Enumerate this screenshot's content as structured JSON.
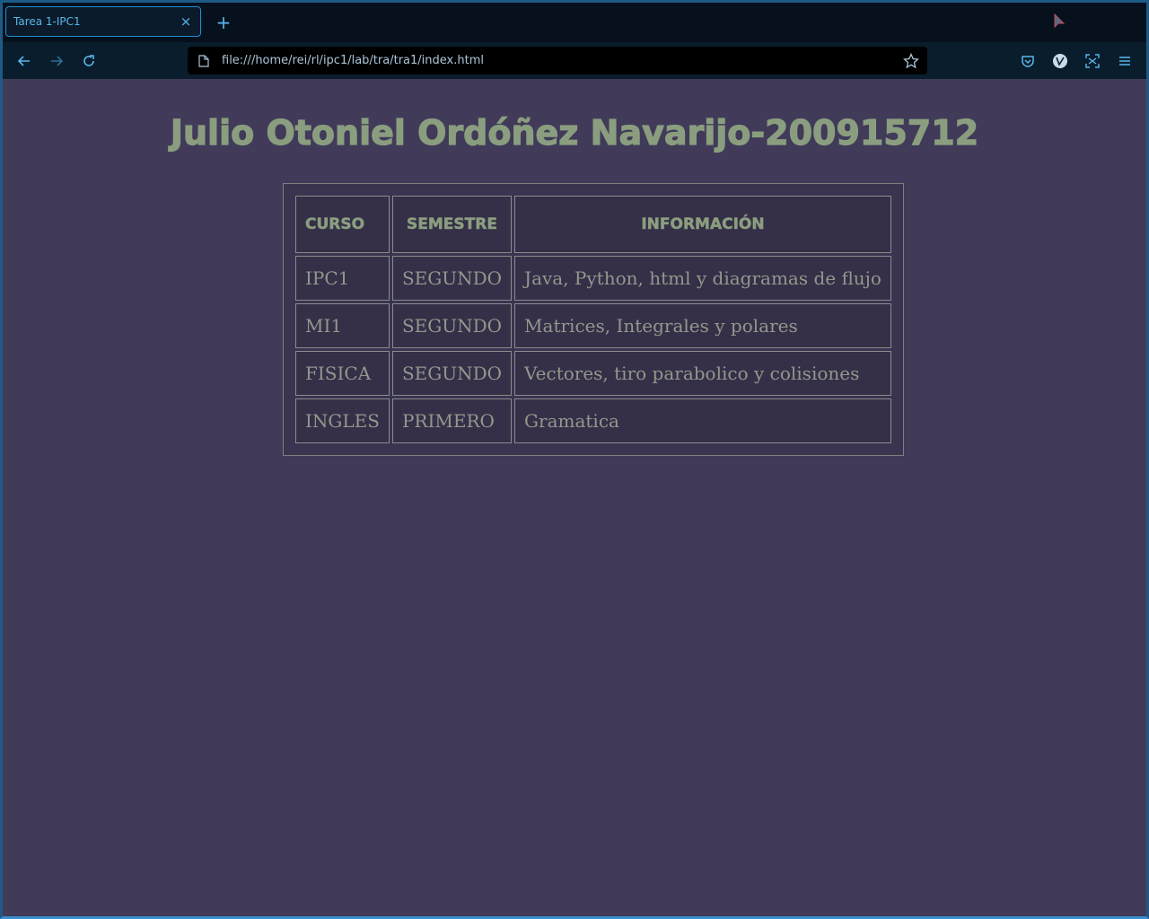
{
  "browser": {
    "tab": {
      "title": "Tarea 1-IPC1",
      "close_icon": "×"
    },
    "new_tab_icon": "+",
    "url": "file:///home/rei/rl/ipc1/lab/tra/tra1/index.html",
    "accent_color": "#1d8fd1"
  },
  "page": {
    "title": "Julio Otoniel Ordóñez Navarijo-200915712",
    "background_color": "#413b59",
    "text_color": "#8a9e7f"
  },
  "table": {
    "headers": [
      "CURSO",
      "SEMESTRE",
      "INFORMACIÓN"
    ],
    "rows": [
      [
        "IPC1",
        "SEGUNDO",
        "Java, Python, html y diagramas de flujo"
      ],
      [
        "MI1",
        "SEGUNDO",
        "Matrices, Integrales y polares"
      ],
      [
        "FISICA",
        "SEGUNDO",
        "Vectores, tiro parabolico y colisiones"
      ],
      [
        "INGLES",
        "PRIMERO",
        "Gramatica"
      ]
    ]
  }
}
